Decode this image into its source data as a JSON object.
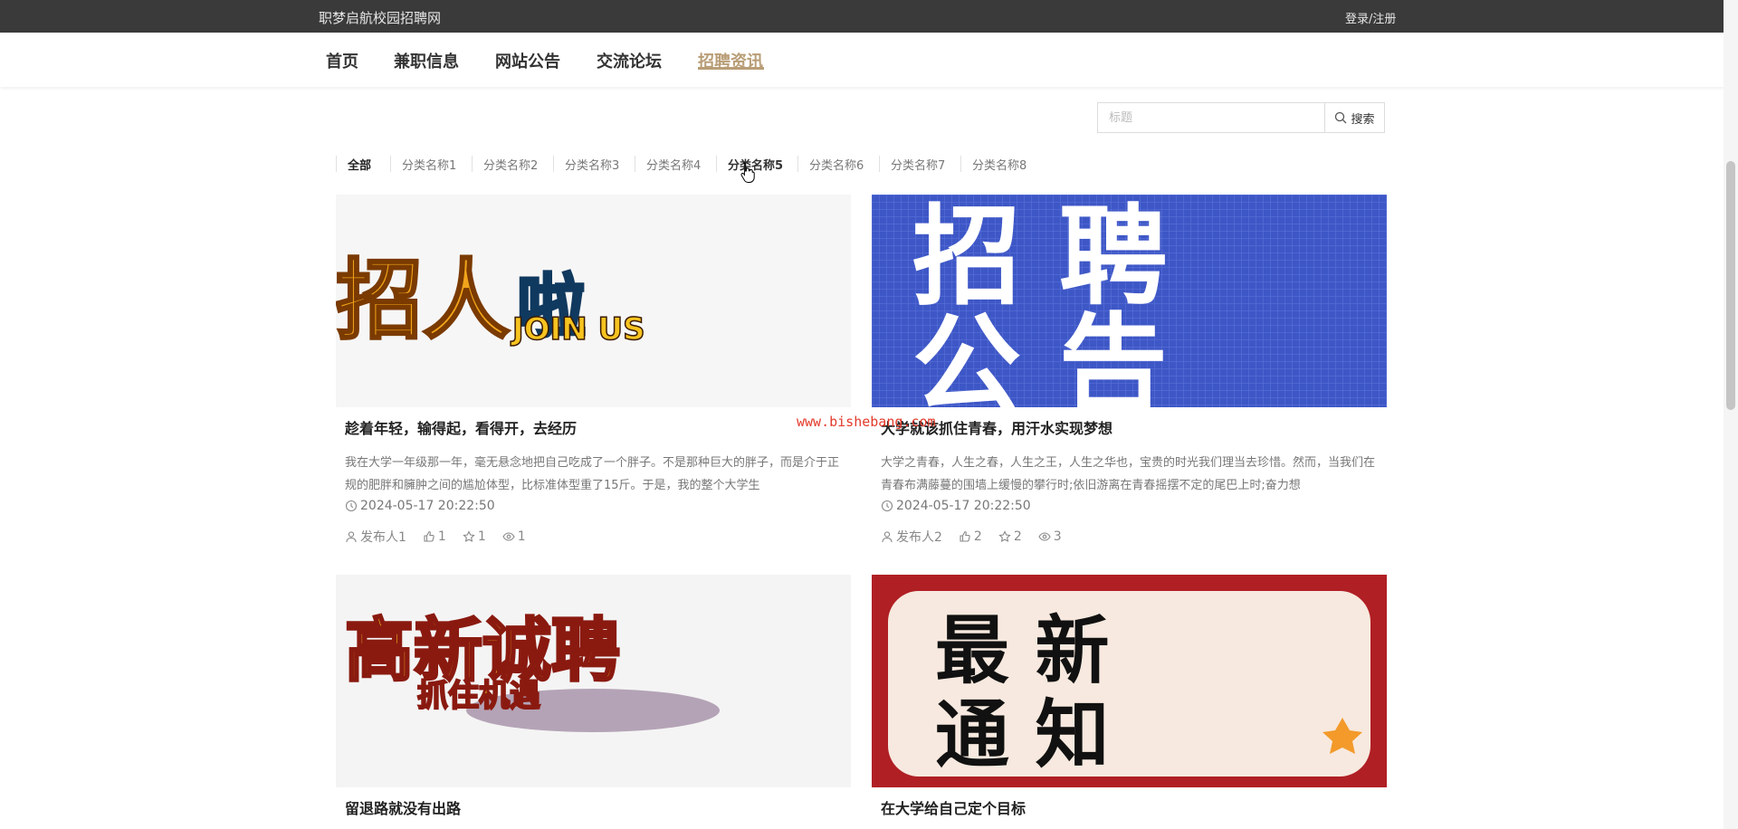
{
  "header": {
    "site_title": "职梦启航校园招聘网",
    "login": "登录/注册"
  },
  "nav": [
    {
      "label": "首页",
      "active": false
    },
    {
      "label": "兼职信息",
      "active": false
    },
    {
      "label": "网站公告",
      "active": false
    },
    {
      "label": "交流论坛",
      "active": false
    },
    {
      "label": "招聘资讯",
      "active": true
    }
  ],
  "search": {
    "placeholder": "标题",
    "button": "搜索"
  },
  "categories": [
    "全部",
    "分类名称1",
    "分类名称2",
    "分类名称3",
    "分类名称4",
    "分类名称5",
    "分类名称6",
    "分类名称7",
    "分类名称8"
  ],
  "cards": [
    {
      "image_text": "招人啦 JOIN US",
      "title": "趁着年轻，输得起，看得开，去经历",
      "desc": "我在大学一年级那一年，毫无悬念地把自己吃成了一个胖子。不是那种巨大的胖子，而是介于正规的肥胖和臃肿之间的尴尬体型，比标准体型重了15斤。于是，我的整个大学生",
      "date": "2024-05-17 20:22:50",
      "author": "发布人1",
      "likes": "1",
      "favorites": "1",
      "views": "1"
    },
    {
      "image_text": "招聘公告",
      "title": "大学就该抓住青春，用汗水实现梦想",
      "desc": "大学之青春，人生之春，人生之王，人生之华也，宝贵的时光我们理当去珍惜。然而，当我们在青春布满藤蔓的围墙上缓慢的攀行时;依旧游离在青春摇摆不定的尾巴上时;奋力想",
      "date": "2024-05-17 20:22:50",
      "author": "发布人2",
      "likes": "2",
      "favorites": "2",
      "views": "3"
    },
    {
      "image_text": "高新诚聘 抓住机遇",
      "title": "留退路就没有出路"
    },
    {
      "image_text": "最新通知",
      "title": "在大学给自己定个目标"
    }
  ],
  "watermark": "www.bishebang.com",
  "colors": {
    "accent": "#b89d76",
    "topbar": "#3a3a3a",
    "blue_banner": "#3e57c6",
    "red_banner": "#b01f24"
  }
}
